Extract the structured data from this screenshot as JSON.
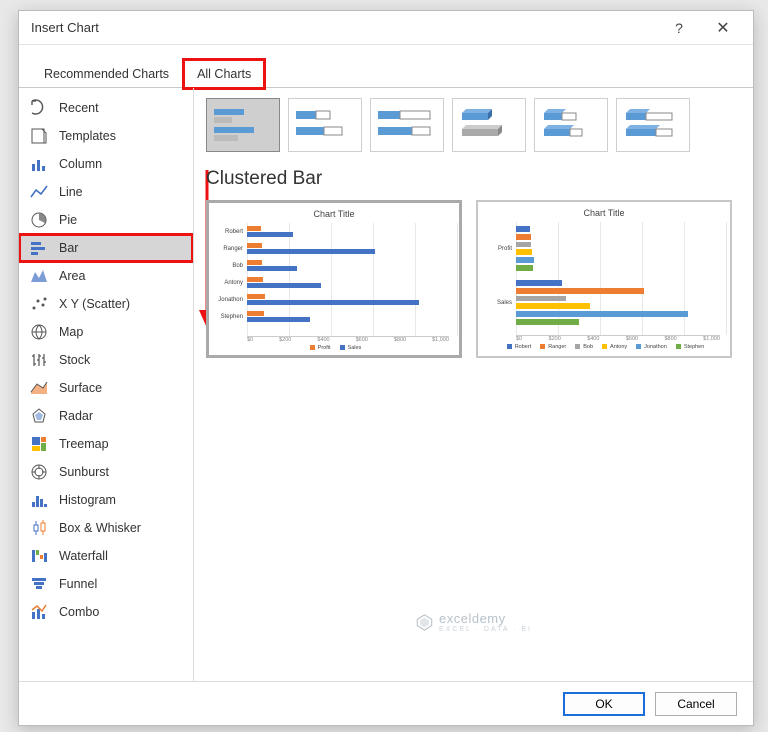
{
  "dialog": {
    "title": "Insert Chart",
    "help": "?",
    "close": "✕"
  },
  "tabs": {
    "recommended": "Recommended Charts",
    "all": "All Charts"
  },
  "chart_types": [
    "Recent",
    "Templates",
    "Column",
    "Line",
    "Pie",
    "Bar",
    "Area",
    "X Y (Scatter)",
    "Map",
    "Stock",
    "Surface",
    "Radar",
    "Treemap",
    "Sunburst",
    "Histogram",
    "Box & Whisker",
    "Waterfall",
    "Funnel",
    "Combo"
  ],
  "selected_type_index": 5,
  "subtype_label": "Clustered Bar",
  "preview": {
    "title": "Chart Title",
    "xticks": [
      "$0",
      "$200",
      "$400",
      "$600",
      "$800",
      "$1,000"
    ],
    "xmax": 1000,
    "legend1": [
      "Profit",
      "Sales"
    ],
    "legend2": [
      "Robert",
      "Ranger",
      "Bob",
      "Antony",
      "Jonathon",
      "Stephen"
    ],
    "categories": [
      "Robert",
      "Ranger",
      "Bob",
      "Antony",
      "Jonathon",
      "Stephen"
    ],
    "groups2": [
      "Profit",
      "Sales"
    ]
  },
  "chart_data": [
    {
      "type": "bar",
      "title": "Chart Title",
      "orientation": "horizontal",
      "categories": [
        "Robert",
        "Ranger",
        "Bob",
        "Antony",
        "Jonathon",
        "Stephen"
      ],
      "series": [
        {
          "name": "Profit",
          "color": "#ed7d31",
          "values": [
            65,
            70,
            70,
            75,
            85,
            80
          ]
        },
        {
          "name": "Sales",
          "color": "#4472c4",
          "values": [
            220,
            610,
            240,
            350,
            820,
            300
          ]
        }
      ],
      "xlim": [
        0,
        1000
      ],
      "xlabel": "",
      "ylabel": ""
    },
    {
      "type": "bar",
      "title": "Chart Title",
      "orientation": "horizontal",
      "categories": [
        "Profit",
        "Sales"
      ],
      "series": [
        {
          "name": "Robert",
          "color": "#4472c4",
          "values": [
            65,
            220
          ]
        },
        {
          "name": "Ranger",
          "color": "#ed7d31",
          "values": [
            70,
            610
          ]
        },
        {
          "name": "Bob",
          "color": "#a5a5a5",
          "values": [
            70,
            240
          ]
        },
        {
          "name": "Antony",
          "color": "#ffc000",
          "values": [
            75,
            350
          ]
        },
        {
          "name": "Jonathon",
          "color": "#5b9bd5",
          "values": [
            85,
            820
          ]
        },
        {
          "name": "Stephen",
          "color": "#70ad47",
          "values": [
            80,
            300
          ]
        }
      ],
      "xlim": [
        0,
        1000
      ],
      "xlabel": "",
      "ylabel": ""
    }
  ],
  "colors": {
    "profit": "#ed7d31",
    "sales": "#4472c4",
    "p": [
      "#4472c4",
      "#ed7d31",
      "#a5a5a5",
      "#ffc000",
      "#5b9bd5",
      "#70ad47"
    ]
  },
  "footer": {
    "ok": "OK",
    "cancel": "Cancel"
  },
  "watermark": {
    "brand": "exceldemy",
    "sub": "EXCEL · DATA · BI"
  }
}
